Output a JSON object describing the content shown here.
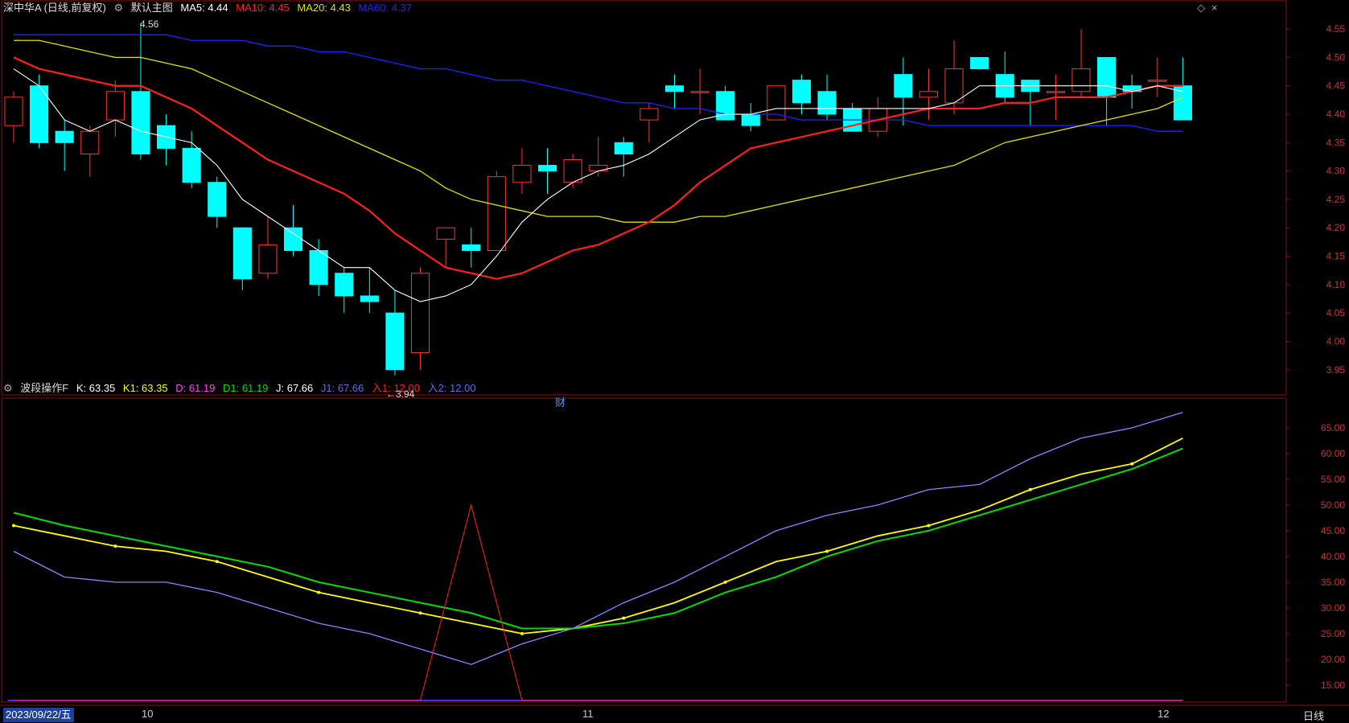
{
  "main_header": {
    "stock": "深中华A (日线,前复权)",
    "view_label": "默认主图",
    "ma5": "MA5: 4.44",
    "ma10": "MA10: 4.45",
    "ma20": "MA20: 4.43",
    "ma60": "MA60: 4.37"
  },
  "sub_header": {
    "indicator": "波段操作F",
    "k": "K: 63.35",
    "k1": "K1: 63.35",
    "d": "D: 61.19",
    "d1": "D1: 61.19",
    "j": "J: 67.66",
    "j1": "J1: 67.66",
    "in1": "入1: 12.00",
    "in2": "入2: 12.00"
  },
  "footer": {
    "date": "2023/09/22/五",
    "period": "日线",
    "month_labels": [
      "10",
      "11",
      "12"
    ]
  },
  "annotations": {
    "high_label": "4.56",
    "low_label": "3.94",
    "marker": "财"
  },
  "colors": {
    "up": "#ff3333",
    "down": "#00ffff",
    "ma5": "#ffffff",
    "ma10": "#ff2020",
    "ma20": "#e0e000",
    "ma60": "#2222ff",
    "k": "#ffff00",
    "d": "#00dd00",
    "j": "#8888ff",
    "in": "#ff2020"
  },
  "icons": [
    "diamond-icon",
    "close-icon",
    "settings-icon"
  ],
  "chart_data": [
    {
      "type": "candlestick",
      "title": "深中华A (日线,前复权)",
      "yticks": [
        3.95,
        4.0,
        4.05,
        4.1,
        4.15,
        4.2,
        4.25,
        4.3,
        4.35,
        4.4,
        4.45,
        4.5,
        4.55
      ],
      "ylim": [
        3.91,
        4.57
      ],
      "candles": [
        {
          "o": 4.38,
          "c": 4.43,
          "h": 4.44,
          "l": 4.35
        },
        {
          "o": 4.45,
          "c": 4.35,
          "h": 4.47,
          "l": 4.34
        },
        {
          "o": 4.37,
          "c": 4.35,
          "h": 4.39,
          "l": 4.3
        },
        {
          "o": 4.33,
          "c": 4.37,
          "h": 4.38,
          "l": 4.29
        },
        {
          "o": 4.39,
          "c": 4.44,
          "h": 4.46,
          "l": 4.36
        },
        {
          "o": 4.44,
          "c": 4.33,
          "h": 4.56,
          "l": 4.32
        },
        {
          "o": 4.38,
          "c": 4.34,
          "h": 4.4,
          "l": 4.31
        },
        {
          "o": 4.34,
          "c": 4.28,
          "h": 4.37,
          "l": 4.27
        },
        {
          "o": 4.28,
          "c": 4.22,
          "h": 4.29,
          "l": 4.2
        },
        {
          "o": 4.2,
          "c": 4.11,
          "h": 4.2,
          "l": 4.09
        },
        {
          "o": 4.12,
          "c": 4.17,
          "h": 4.22,
          "l": 4.11
        },
        {
          "o": 4.2,
          "c": 4.16,
          "h": 4.24,
          "l": 4.15
        },
        {
          "o": 4.16,
          "c": 4.1,
          "h": 4.18,
          "l": 4.08
        },
        {
          "o": 4.12,
          "c": 4.08,
          "h": 4.13,
          "l": 4.05
        },
        {
          "o": 4.08,
          "c": 4.07,
          "h": 4.13,
          "l": 4.05
        },
        {
          "o": 4.05,
          "c": 3.95,
          "h": 4.09,
          "l": 3.94
        },
        {
          "o": 3.98,
          "c": 4.12,
          "h": 4.13,
          "l": 3.95
        },
        {
          "o": 4.18,
          "c": 4.2,
          "h": 4.2,
          "l": 4.13
        },
        {
          "o": 4.17,
          "c": 4.16,
          "h": 4.2,
          "l": 4.13
        },
        {
          "o": 4.16,
          "c": 4.29,
          "h": 4.3,
          "l": 4.16
        },
        {
          "o": 4.28,
          "c": 4.31,
          "h": 4.34,
          "l": 4.26
        },
        {
          "o": 4.31,
          "c": 4.3,
          "h": 4.34,
          "l": 4.26
        },
        {
          "o": 4.28,
          "c": 4.32,
          "h": 4.33,
          "l": 4.27
        },
        {
          "o": 4.3,
          "c": 4.31,
          "h": 4.36,
          "l": 4.29
        },
        {
          "o": 4.35,
          "c": 4.33,
          "h": 4.36,
          "l": 4.29
        },
        {
          "o": 4.39,
          "c": 4.41,
          "h": 4.42,
          "l": 4.35
        },
        {
          "o": 4.45,
          "c": 4.44,
          "h": 4.47,
          "l": 4.41
        },
        {
          "o": 4.44,
          "c": 4.44,
          "h": 4.48,
          "l": 4.4
        },
        {
          "o": 4.44,
          "c": 4.39,
          "h": 4.45,
          "l": 4.39
        },
        {
          "o": 4.4,
          "c": 4.38,
          "h": 4.42,
          "l": 4.37
        },
        {
          "o": 4.39,
          "c": 4.45,
          "h": 4.45,
          "l": 4.39
        },
        {
          "o": 4.46,
          "c": 4.42,
          "h": 4.47,
          "l": 4.4
        },
        {
          "o": 4.44,
          "c": 4.4,
          "h": 4.47,
          "l": 4.39
        },
        {
          "o": 4.41,
          "c": 4.37,
          "h": 4.42,
          "l": 4.37
        },
        {
          "o": 4.37,
          "c": 4.41,
          "h": 4.43,
          "l": 4.36
        },
        {
          "o": 4.47,
          "c": 4.43,
          "h": 4.5,
          "l": 4.38
        },
        {
          "o": 4.43,
          "c": 4.44,
          "h": 4.48,
          "l": 4.39
        },
        {
          "o": 4.42,
          "c": 4.48,
          "h": 4.53,
          "l": 4.4
        },
        {
          "o": 4.5,
          "c": 4.48,
          "h": 4.5,
          "l": 4.48
        },
        {
          "o": 4.47,
          "c": 4.43,
          "h": 4.51,
          "l": 4.42
        },
        {
          "o": 4.46,
          "c": 4.44,
          "h": 4.46,
          "l": 4.38
        },
        {
          "o": 4.44,
          "c": 4.44,
          "h": 4.47,
          "l": 4.39
        },
        {
          "o": 4.44,
          "c": 4.48,
          "h": 4.55,
          "l": 4.43
        },
        {
          "o": 4.5,
          "c": 4.43,
          "h": 4.5,
          "l": 4.38
        },
        {
          "o": 4.45,
          "c": 4.44,
          "h": 4.47,
          "l": 4.41
        },
        {
          "o": 4.46,
          "c": 4.46,
          "h": 4.5,
          "l": 4.43
        },
        {
          "o": 4.45,
          "c": 4.39,
          "h": 4.5,
          "l": 4.39
        }
      ],
      "ma5": [
        4.48,
        4.45,
        4.39,
        4.37,
        4.39,
        4.37,
        4.36,
        4.35,
        4.31,
        4.25,
        4.22,
        4.19,
        4.16,
        4.13,
        4.13,
        4.09,
        4.07,
        4.08,
        4.1,
        4.15,
        4.21,
        4.25,
        4.28,
        4.3,
        4.31,
        4.33,
        4.36,
        4.39,
        4.4,
        4.4,
        4.41,
        4.41,
        4.41,
        4.41,
        4.41,
        4.41,
        4.41,
        4.42,
        4.45,
        4.45,
        4.45,
        4.45,
        4.45,
        4.45,
        4.44,
        4.45,
        4.44
      ],
      "ma10": [
        4.5,
        4.48,
        4.47,
        4.46,
        4.45,
        4.45,
        4.43,
        4.41,
        4.38,
        4.35,
        4.32,
        4.3,
        4.28,
        4.26,
        4.23,
        4.19,
        4.16,
        4.13,
        4.12,
        4.11,
        4.12,
        4.14,
        4.16,
        4.17,
        4.19,
        4.21,
        4.24,
        4.28,
        4.31,
        4.34,
        4.35,
        4.36,
        4.37,
        4.38,
        4.39,
        4.4,
        4.41,
        4.41,
        4.41,
        4.42,
        4.42,
        4.43,
        4.43,
        4.43,
        4.44,
        4.45,
        4.45
      ],
      "ma20": [
        4.53,
        4.53,
        4.52,
        4.51,
        4.5,
        4.5,
        4.49,
        4.48,
        4.46,
        4.44,
        4.42,
        4.4,
        4.38,
        4.36,
        4.34,
        4.32,
        4.3,
        4.27,
        4.25,
        4.24,
        4.23,
        4.22,
        4.22,
        4.22,
        4.21,
        4.21,
        4.21,
        4.22,
        4.22,
        4.23,
        4.24,
        4.25,
        4.26,
        4.27,
        4.28,
        4.29,
        4.3,
        4.31,
        4.33,
        4.35,
        4.36,
        4.37,
        4.38,
        4.39,
        4.4,
        4.41,
        4.43
      ],
      "ma60": [
        4.54,
        4.54,
        4.54,
        4.54,
        4.54,
        4.54,
        4.54,
        4.53,
        4.53,
        4.53,
        4.52,
        4.52,
        4.51,
        4.51,
        4.5,
        4.49,
        4.48,
        4.48,
        4.47,
        4.46,
        4.46,
        4.45,
        4.44,
        4.43,
        4.42,
        4.42,
        4.41,
        4.41,
        4.4,
        4.4,
        4.4,
        4.39,
        4.39,
        4.39,
        4.39,
        4.39,
        4.38,
        4.38,
        4.38,
        4.38,
        4.38,
        4.38,
        4.38,
        4.38,
        4.38,
        4.37,
        4.37
      ]
    },
    {
      "type": "line",
      "title": "波段操作F",
      "yticks": [
        15,
        20,
        25,
        30,
        35,
        40,
        45,
        50,
        55,
        60,
        65
      ],
      "ylim": [
        12,
        70
      ],
      "x": [
        0,
        2,
        4,
        6,
        8,
        10,
        12,
        14,
        16,
        18,
        20,
        22,
        24,
        26,
        28,
        30,
        32,
        34,
        36,
        38,
        40,
        42,
        44,
        46
      ],
      "series": [
        {
          "name": "K",
          "values": [
            46,
            44,
            42,
            41,
            39,
            36,
            33,
            31,
            29,
            27,
            25,
            26,
            28,
            31,
            35,
            39,
            41,
            44,
            46,
            49,
            53,
            56,
            58,
            63
          ]
        },
        {
          "name": "D",
          "values": [
            48.5,
            46,
            44,
            42,
            40,
            38,
            35,
            33,
            31,
            29,
            26,
            26,
            27,
            29,
            33,
            36,
            40,
            43,
            45,
            48,
            51,
            54,
            57,
            61
          ]
        },
        {
          "name": "J",
          "values": [
            41,
            36,
            35,
            35,
            33,
            30,
            27,
            25,
            22,
            19,
            23,
            26,
            31,
            35,
            40,
            45,
            48,
            50,
            53,
            54,
            59,
            63,
            65,
            68
          ]
        },
        {
          "name": "入1",
          "values": [
            12,
            12,
            12,
            12,
            12,
            12,
            12,
            12,
            12,
            50,
            12,
            12,
            12,
            12,
            12,
            12,
            12,
            12,
            12,
            12,
            12,
            12,
            12,
            12
          ]
        }
      ]
    }
  ]
}
